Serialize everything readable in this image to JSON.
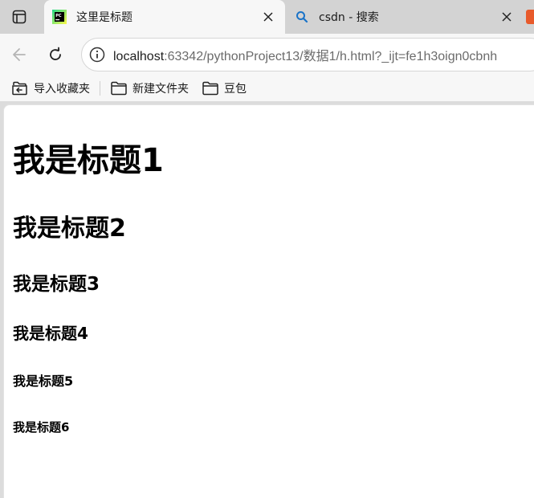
{
  "browser": {
    "tabs": [
      {
        "title": "这里是标题",
        "favicon": "pycharm-icon",
        "active": true
      },
      {
        "title": "csdn - 搜索",
        "favicon": "search-icon",
        "active": false
      }
    ],
    "address": {
      "host": "localhost",
      "rest": ":63342/pythonProject13/数据1/h.html?_ijt=fe1h3oign0cbnh"
    },
    "bookmarks": [
      {
        "label": "导入收藏夹",
        "icon": "import-favorites-icon"
      },
      {
        "label": "新建文件夹",
        "icon": "folder-icon"
      },
      {
        "label": "豆包",
        "icon": "folder-icon"
      }
    ]
  },
  "page": {
    "h1": "我是标题1",
    "h2": "我是标题2",
    "h3": "我是标题3",
    "h4": "我是标题4",
    "h5": "我是标题5",
    "h6": "我是标题6"
  },
  "colors": {
    "tabstrip": "#d3d3d3",
    "toolbar": "#f7f7f7",
    "page_background": "#ffffff"
  }
}
